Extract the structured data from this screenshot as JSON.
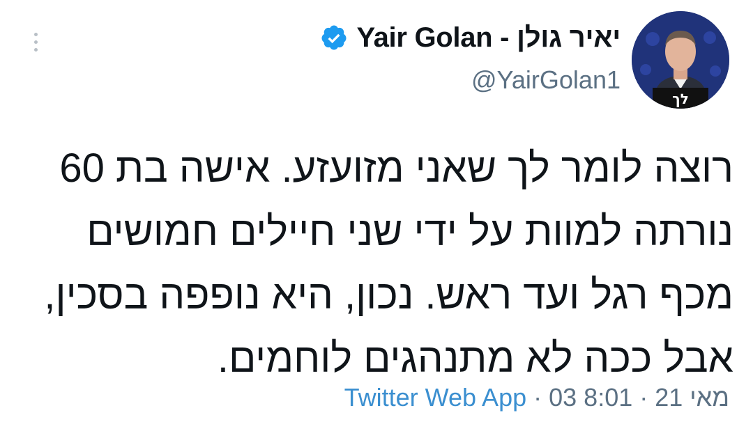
{
  "tweet": {
    "author": {
      "display_name": "Yair Golan - יאיר גולן",
      "handle": "@YairGolan1",
      "verified": true,
      "avatar_badge_text": "לך"
    },
    "text_lines": [
      "רוצה לומר לך שאני מזועזע. אישה בת 60",
      "נורתה למוות על ידי שני חיילים חמושים",
      "מכף רגל ועד ראש. נכון, היא נופפה בסכין,",
      "אבל ככה לא מתנהגים לוחמים."
    ],
    "meta": {
      "time": "8:01",
      "separator": " · ",
      "date": "03 מאי 21",
      "source": "Twitter Web App"
    }
  },
  "colors": {
    "primary_text": "#0f1419",
    "secondary_text": "#5b7083",
    "link": "#3b8fd0",
    "verified_badge": "#1d9bf0"
  },
  "icons": {
    "more": "vertical-ellipsis-icon",
    "verified": "verified-badge-icon"
  }
}
